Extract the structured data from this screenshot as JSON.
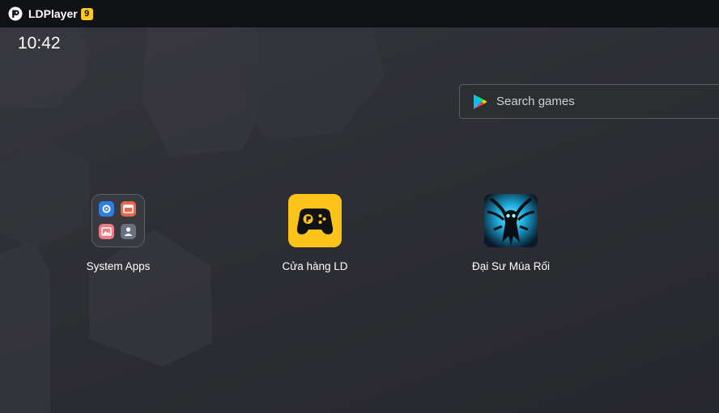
{
  "titlebar": {
    "title": "LDPlayer",
    "version": "9"
  },
  "clock": "10:42",
  "search": {
    "placeholder": "Search games",
    "icon": "google-play-icon"
  },
  "apps": [
    {
      "label": "System Apps",
      "icon": "folder-icon"
    },
    {
      "label": "Cửa hàng LD",
      "icon": "ld-store-icon"
    },
    {
      "label": "Đại Sư Múa Rối",
      "icon": "game-puppet-master-icon"
    }
  ],
  "colors": {
    "titlebar": "#111216",
    "badge": "#ffc928",
    "store": "#fcc419",
    "desktop": "#2b2c31"
  }
}
